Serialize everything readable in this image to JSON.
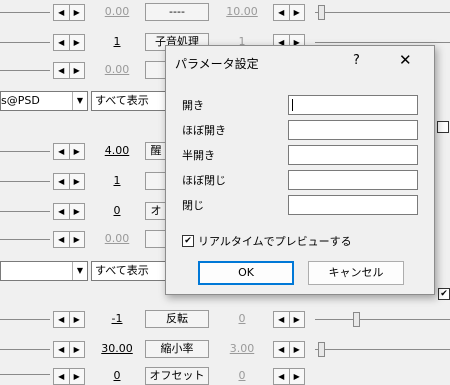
{
  "background": {
    "rows": [
      {
        "value": "0.00",
        "button": "----",
        "right_value": "10.00",
        "value_dim": true,
        "right_dim": true
      },
      {
        "value": "1",
        "button": "子音処理",
        "right_value": "1",
        "value_dim": false,
        "right_dim": true
      },
      {
        "value": "0.00",
        "button": "",
        "right_value": "",
        "value_dim": true,
        "right_dim": true
      },
      {
        "value": "4.00",
        "button": "醒",
        "right_value": "",
        "value_dim": false,
        "right_dim": true
      },
      {
        "value": "1",
        "button": "",
        "right_value": "",
        "value_dim": false,
        "right_dim": true
      },
      {
        "value": "0",
        "button": "オ",
        "right_value": "",
        "value_dim": false,
        "right_dim": true
      },
      {
        "value": "0.00",
        "button": "",
        "right_value": "",
        "value_dim": true,
        "right_dim": true
      },
      {
        "value": "-1",
        "button": "反転",
        "right_value": "0",
        "value_dim": false,
        "right_dim": true
      },
      {
        "value": "30.00",
        "button": "縮小率",
        "right_value": "3.00",
        "value_dim": false,
        "right_dim": true
      },
      {
        "value": "0",
        "button": "オフセットX",
        "right_value": "0",
        "value_dim": false,
        "right_dim": true
      }
    ],
    "layer_combo": "s@PSD",
    "show_all_combo_1": "すべて表示",
    "show_all_combo_2": "すべて表示",
    "spin_left": "◀",
    "spin_right": "▶",
    "combo_arrow": "▼",
    "right_checkbox_mark": "✔"
  },
  "dialog": {
    "title": "パラメータ設定",
    "help": "?",
    "close": "✕",
    "params": [
      {
        "label": "開き",
        "value": ""
      },
      {
        "label": "ほぼ開き",
        "value": ""
      },
      {
        "label": "半開き",
        "value": ""
      },
      {
        "label": "ほぼ閉じ",
        "value": ""
      },
      {
        "label": "閉じ",
        "value": ""
      }
    ],
    "preview": {
      "label": "リアルタイムでプレビューする",
      "checked": true,
      "mark": "✔"
    },
    "ok_label": "OK",
    "cancel_label": "キャンセル"
  }
}
